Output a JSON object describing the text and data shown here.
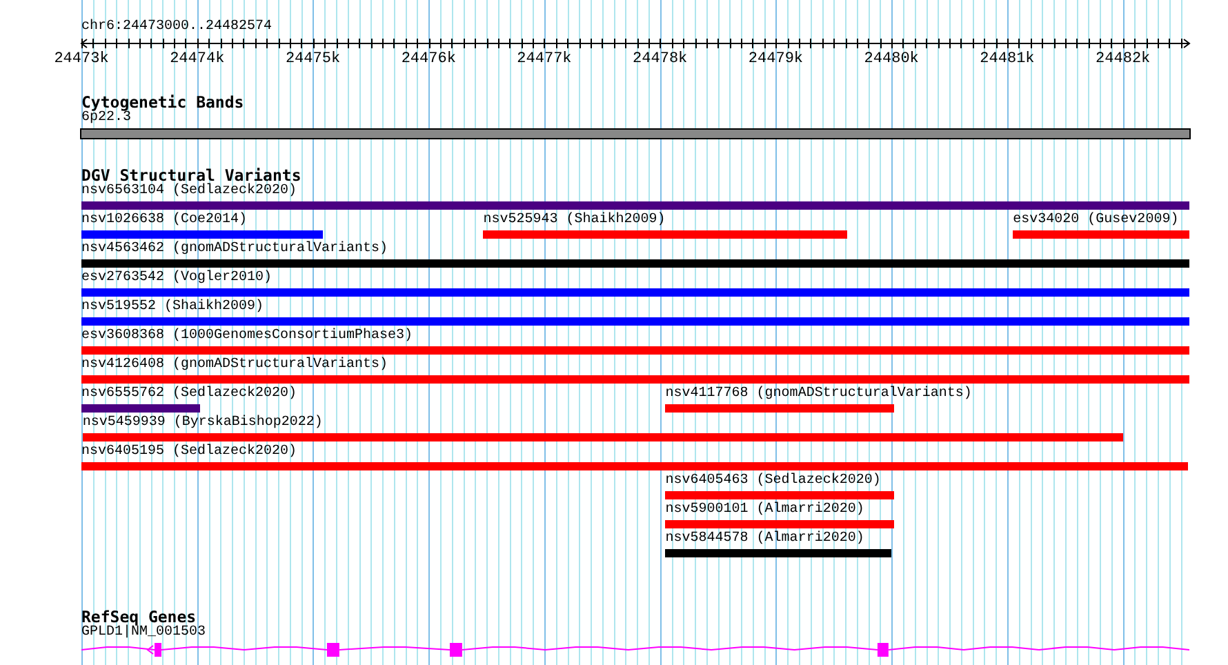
{
  "ruler": {
    "location": "chr6:24473000..24482574",
    "ticks": [
      "24473k",
      "24474k",
      "24475k",
      "24476k",
      "24477k",
      "24478k",
      "24479k",
      "24480k",
      "24481k",
      "24482k"
    ]
  },
  "tracks": [
    {
      "kind": "bands",
      "title": "Cytogenetic Bands",
      "bands": [
        {
          "name": "6p22.3"
        }
      ]
    },
    {
      "kind": "variants",
      "title": "DGV Structural Variants",
      "rows": [
        [
          {
            "label": "nsv6563104 (Sedlazeck2020)",
            "color": "#4b0082"
          }
        ],
        [
          {
            "label": "nsv1026638 (Coe2014)",
            "color": "#0000ff"
          },
          {
            "label": "nsv525943 (Shaikh2009)",
            "color": "#ff0000"
          },
          {
            "label": "esv34020 (Gusev2009)",
            "color": "#ff0000"
          }
        ],
        [
          {
            "label": "nsv4563462 (gnomADStructuralVariants)",
            "color": "#000000"
          }
        ],
        [
          {
            "label": "esv2763542 (Vogler2010)",
            "color": "#0000ff"
          }
        ],
        [
          {
            "label": "nsv519552 (Shaikh2009)",
            "color": "#0000ff"
          }
        ],
        [
          {
            "label": "esv3608368 (1000GenomesConsortiumPhase3)",
            "color": "#ff0000"
          }
        ],
        [
          {
            "label": "nsv4126408 (gnomADStructuralVariants)",
            "color": "#ff0000"
          }
        ],
        [
          {
            "label": "nsv6555762 (Sedlazeck2020)",
            "color": "#4b0082"
          },
          {
            "label": "nsv4117768 (gnomADStructuralVariants)",
            "color": "#ff0000"
          }
        ],
        [
          {
            "label": "nsv5459939 (ByrskaBishop2022)",
            "color": "#ff0000"
          }
        ],
        [
          {
            "label": "nsv6405195 (Sedlazeck2020)",
            "color": "#ff0000"
          }
        ],
        [
          {
            "label": "nsv6405463 (Sedlazeck2020)",
            "color": "#ff0000"
          }
        ],
        [
          {
            "label": "nsv5900101 (Almarri2020)",
            "color": "#ff0000"
          }
        ],
        [
          {
            "label": "nsv5844578 (Almarri2020)",
            "color": "#000000"
          }
        ]
      ]
    },
    {
      "kind": "genes",
      "title": "RefSeq Genes",
      "genes": [
        {
          "name": "GPLD1|NM_001503",
          "reverse": true
        }
      ]
    }
  ]
}
